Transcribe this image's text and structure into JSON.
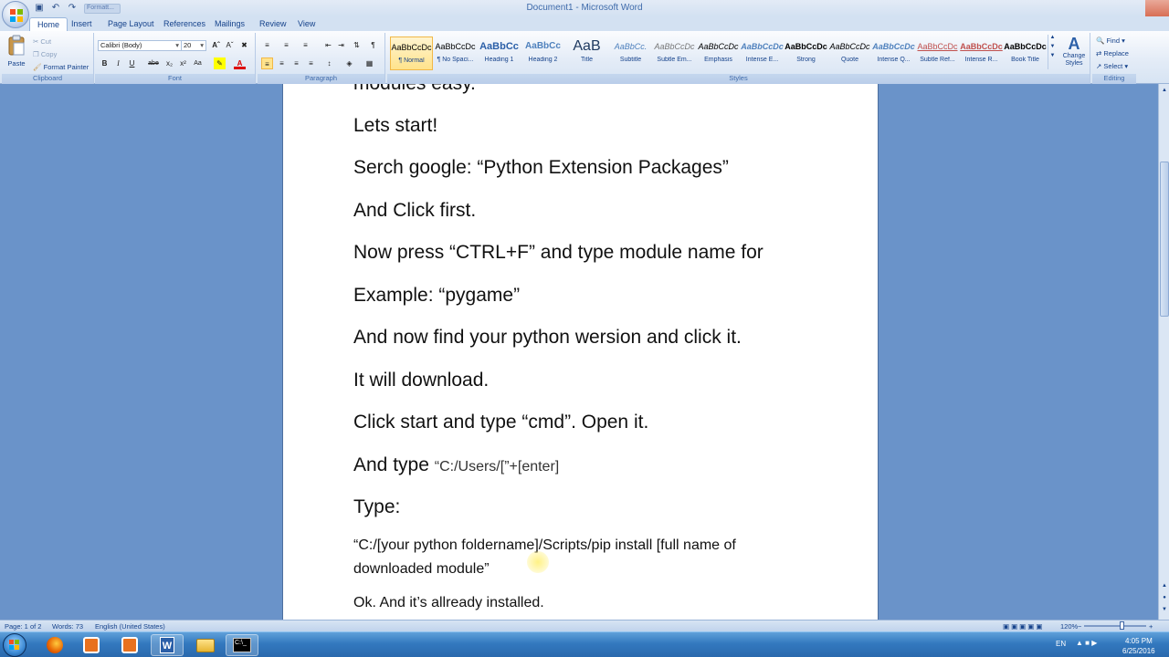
{
  "window": {
    "title": "Document1 - Microsoft Word",
    "qat_tab_label": "Formatt..."
  },
  "tabs": [
    {
      "label": "Home",
      "active": true
    },
    {
      "label": "Insert"
    },
    {
      "label": "Page Layout"
    },
    {
      "label": "References"
    },
    {
      "label": "Mailings"
    },
    {
      "label": "Review"
    },
    {
      "label": "View"
    }
  ],
  "clipboard": {
    "paste": "Paste",
    "cut": "Cut",
    "copy": "Copy",
    "format_painter": "Format Painter",
    "label": "Clipboard"
  },
  "font": {
    "name": "Calibri (Body)",
    "size": "20",
    "label": "Font",
    "bold": "B",
    "italic": "I",
    "underline": "U",
    "strike": "abe",
    "subscript": "x₂",
    "superscript": "x²",
    "change_case": "Aa"
  },
  "paragraph": {
    "label": "Paragraph"
  },
  "styles": {
    "label": "Styles",
    "items": [
      {
        "preview": "AaBbCcDc",
        "name": "¶ Normal",
        "selected": true
      },
      {
        "preview": "AaBbCcDc",
        "name": "¶ No Spaci..."
      },
      {
        "preview": "AaBbCc",
        "name": "Heading 1"
      },
      {
        "preview": "AaBbCc",
        "name": "Heading 2"
      },
      {
        "preview": "AaB",
        "name": "Title"
      },
      {
        "preview": "AaBbCc.",
        "name": "Subtitle"
      },
      {
        "preview": "AaBbCcDc",
        "name": "Subtle Em..."
      },
      {
        "preview": "AaBbCcDc",
        "name": "Emphasis"
      },
      {
        "preview": "AaBbCcDc",
        "name": "Intense E..."
      },
      {
        "preview": "AaBbCcDc",
        "name": "Strong"
      },
      {
        "preview": "AaBbCcDc",
        "name": "Quote"
      },
      {
        "preview": "AaBbCcDc",
        "name": "Intense Q..."
      },
      {
        "preview": "AaBbCcDc",
        "name": "Subtle Ref..."
      },
      {
        "preview": "AaBbCcDc",
        "name": "Intense R..."
      },
      {
        "preview": "AaBbCcDc",
        "name": "Book Title"
      }
    ],
    "change_styles": "Change Styles"
  },
  "editing": {
    "label": "Editing",
    "find": "Find",
    "replace": "Replace",
    "select": "Select"
  },
  "document": {
    "lines": [
      "modules easy.",
      "Lets start!",
      "Serch google: “Python Extension Packages”",
      "And Click first.",
      "Now press “CTRL+F” and type module name for",
      "Example: “pygame”",
      "And now find your python wersion and click it.",
      "It will download.",
      "Click start and type “cmd”. Open it.",
      "And type",
      "“C:/Users/[”+[enter]",
      "Type:",
      "“C:/[your python foldername]/Scripts/pip install [full name of",
      "downloaded module”",
      "Ok. And it’s allready installed."
    ]
  },
  "status": {
    "page": "Page: 1 of 2",
    "words": "Words: 73",
    "language": "English (United States)",
    "zoom": "120%"
  },
  "taskbar": {
    "lang": "EN",
    "time": "4:05 PM",
    "date": "6/25/2016"
  }
}
